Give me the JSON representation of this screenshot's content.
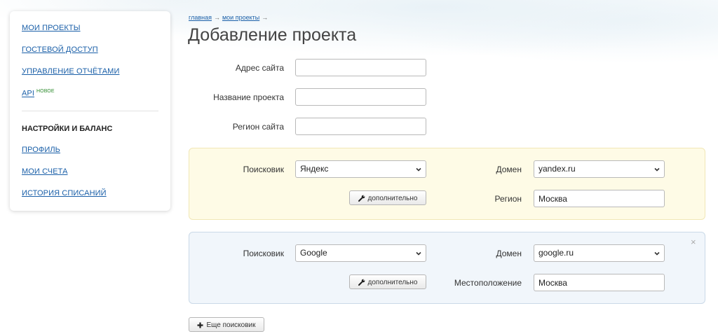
{
  "sidebar": {
    "links": [
      {
        "label": "МОИ ПРОЕКТЫ"
      },
      {
        "label": "ГОСТЕВОЙ ДОСТУП"
      },
      {
        "label": "УПРАВЛЕНИЕ ОТЧЁТАМИ"
      },
      {
        "label": "API",
        "badge": "НОВОЕ"
      }
    ],
    "section_title": "НАСТРОЙКИ И БАЛАНС",
    "settings_links": [
      {
        "label": "ПРОФИЛЬ"
      },
      {
        "label": "МОИ СЧЕТА"
      },
      {
        "label": "ИСТОРИЯ СПИСАНИЙ"
      }
    ]
  },
  "breadcrumb": {
    "items": [
      "главная",
      "мои проекты"
    ],
    "separator": "→"
  },
  "page_title": "Добавление проекта",
  "form": {
    "site_address_label": "Адрес сайта",
    "site_address_value": "",
    "project_name_label": "Название проекта",
    "project_name_value": "",
    "site_region_label": "Регион сайта",
    "site_region_value": ""
  },
  "engines": [
    {
      "engine_label": "Поисковик",
      "engine_value": "Яндекс",
      "domain_label": "Домен",
      "domain_value": "yandex.ru",
      "more_button": "дополнительно",
      "region_label": "Регион",
      "region_value": "Москва",
      "bg_color": "#fefbe6"
    },
    {
      "engine_label": "Поисковик",
      "engine_value": "Google",
      "domain_label": "Домен",
      "domain_value": "google.ru",
      "more_button": "дополнительно",
      "region_label": "Местоположение",
      "region_value": "Москва",
      "close_label": "×",
      "bg_color": "#f1f6fb"
    }
  ],
  "add_engine_button": "Еще поисковик",
  "colors": {
    "link": "#1a5fa8",
    "badge": "#2e8b2e"
  },
  "icons": {
    "more": "wrench-icon",
    "add": "plus-icon",
    "dropdown": "chevron-down-icon",
    "close": "close-icon"
  }
}
